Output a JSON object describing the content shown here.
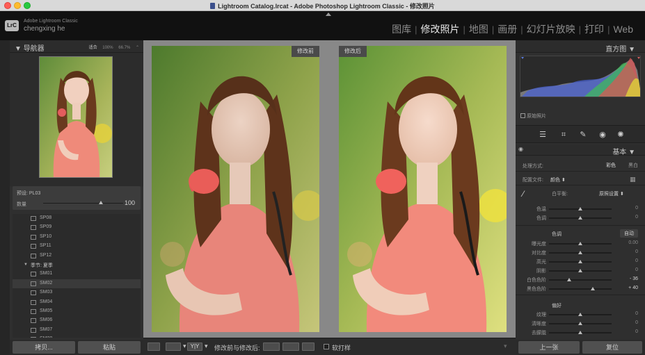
{
  "window": {
    "title": "Lightroom Catalog.lrcat - Adobe Photoshop Lightroom Classic - 修改照片"
  },
  "identity": {
    "app_line": "Adobe Lightroom Classic",
    "user": "chengxing he",
    "logo": "LrC"
  },
  "modules": [
    {
      "label": "图库",
      "active": false
    },
    {
      "label": "修改照片",
      "active": true
    },
    {
      "label": "地图",
      "active": false
    },
    {
      "label": "画册",
      "active": false
    },
    {
      "label": "幻灯片放映",
      "active": false
    },
    {
      "label": "打印",
      "active": false
    },
    {
      "label": "Web",
      "active": false
    }
  ],
  "navigator": {
    "title": "导航器",
    "zoom_fit": "适合",
    "zoom_100": "100%",
    "zoom_667": "66.7%"
  },
  "preset": {
    "label": "预设: PL03",
    "amount_label": "数量",
    "amount_value": "100",
    "amount_fraction": 0.72
  },
  "preset_list": [
    {
      "name": "SP08",
      "type": "item"
    },
    {
      "name": "SP09",
      "type": "item"
    },
    {
      "name": "SP10",
      "type": "item"
    },
    {
      "name": "SP11",
      "type": "item"
    },
    {
      "name": "SP12",
      "type": "item"
    },
    {
      "name": "季节: 夏季",
      "type": "folder"
    },
    {
      "name": "SM01",
      "type": "item"
    },
    {
      "name": "SM02",
      "type": "item",
      "selected": true
    },
    {
      "name": "SM03",
      "type": "item"
    },
    {
      "name": "SM04",
      "type": "item"
    },
    {
      "name": "SM05",
      "type": "item"
    },
    {
      "name": "SM06",
      "type": "item"
    },
    {
      "name": "SM07",
      "type": "item"
    },
    {
      "name": "SM08",
      "type": "item"
    }
  ],
  "left_buttons": {
    "copy": "拷贝...",
    "paste": "粘贴"
  },
  "compare": {
    "before_label": "修改前",
    "after_label": "修改后"
  },
  "toolbar": {
    "yy": "Y|Y",
    "compare_label": "修改前与修改后:",
    "soft_proof": "软打样"
  },
  "histogram": {
    "title": "直方图",
    "original": "原始照片"
  },
  "basic": {
    "title": "基本",
    "treatment_label": "处理方式:",
    "color": "彩色",
    "bw": "黑白",
    "profile_label": "配置文件:",
    "profile_value": "颜色",
    "wb_label": "白平衡:",
    "wb_value": "原照设置",
    "tone_label": "色调",
    "auto": "自动",
    "presence_label": "偏好",
    "sliders_wb": [
      {
        "label": "色温",
        "value": "0",
        "pos": 0.5
      },
      {
        "label": "色调",
        "value": "0",
        "pos": 0.5
      }
    ],
    "sliders_tone": [
      {
        "label": "曝光度",
        "value": "0.00",
        "pos": 0.5
      },
      {
        "label": "对比度",
        "value": "0",
        "pos": 0.5
      },
      {
        "label": "高光",
        "value": "0",
        "pos": 0.5
      },
      {
        "label": "阴影",
        "value": "0",
        "pos": 0.5
      },
      {
        "label": "白色色阶",
        "value": "- 36",
        "pos": 0.32,
        "strong": true
      },
      {
        "label": "黑色色阶",
        "value": "+ 40",
        "pos": 0.7,
        "strong": true
      }
    ],
    "sliders_presence": [
      {
        "label": "纹理",
        "value": "0",
        "pos": 0.5
      },
      {
        "label": "清晰度",
        "value": "0",
        "pos": 0.5
      },
      {
        "label": "去朦胧",
        "value": "0",
        "pos": 0.5
      }
    ]
  },
  "right_buttons": {
    "prev": "上一张",
    "reset": "复位"
  }
}
